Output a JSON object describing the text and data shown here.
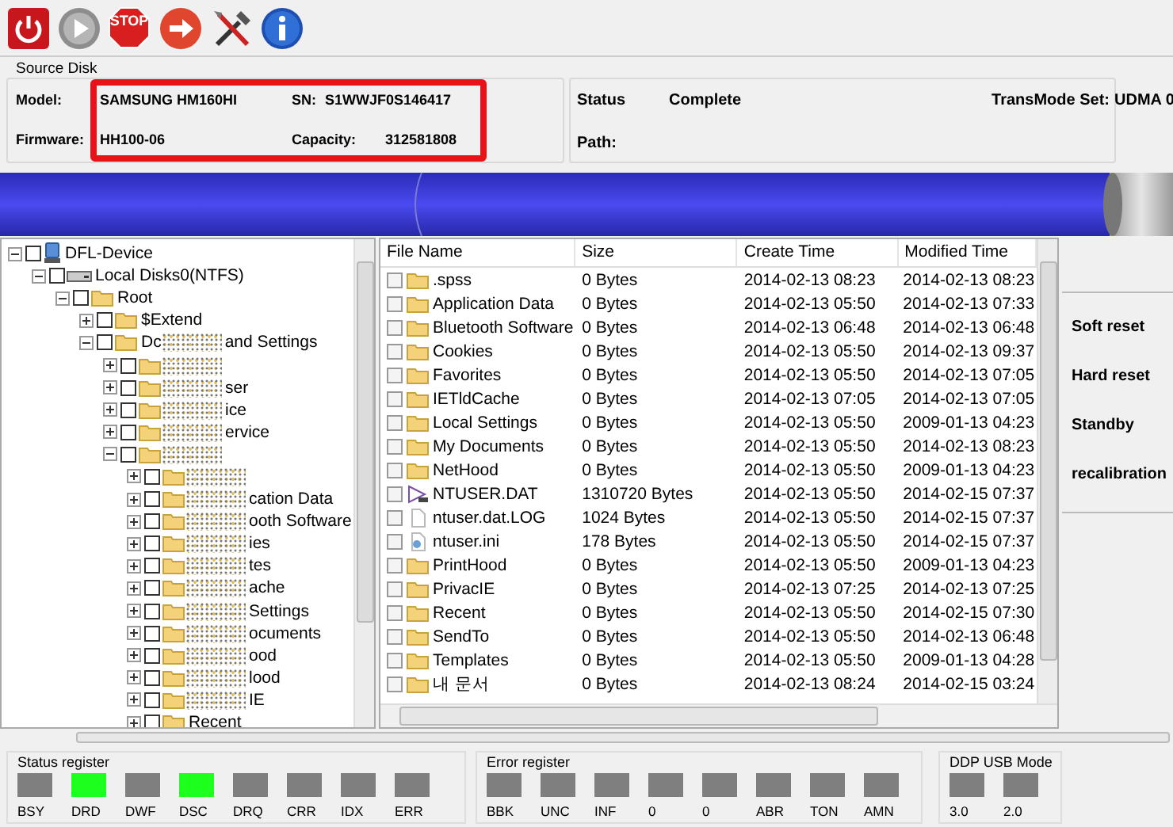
{
  "toolbar": [
    {
      "kind": "power"
    },
    {
      "kind": "play"
    },
    {
      "kind": "stop",
      "text": "STOP"
    },
    {
      "kind": "next"
    },
    {
      "kind": "tools"
    },
    {
      "kind": "info"
    }
  ],
  "source_disk": {
    "title": "Source Disk",
    "highlighted": true,
    "fields": [
      {
        "label": "Model:",
        "value": "SAMSUNG HM160HI"
      },
      {
        "label": "SN:",
        "value": "S1WWJF0S146417"
      },
      {
        "label": "Firmware:",
        "value": "HH100-06"
      },
      {
        "label": "Capacity:",
        "value": "312581808"
      }
    ]
  },
  "status_panel": {
    "status_label": "Status",
    "status": "Complete",
    "path_label": "Path:",
    "transmode_label": "TransMode Set:",
    "transmode": "UDMA 0"
  },
  "tree": [
    {
      "kind": "device",
      "label": "DFL-Device",
      "checked": false,
      "expanded": true,
      "children": [
        {
          "kind": "disk",
          "label": "Local Disks0(NTFS)",
          "checked": false,
          "expanded": true,
          "children": [
            {
              "kind": "folder",
              "label": "Root",
              "checked": false,
              "expanded": true,
              "children": [
                {
                  "kind": "folder",
                  "label": "$Extend",
                  "checked": false,
                  "expanded": false
                },
                {
                  "kind": "folder",
                  "prefix": "Dc",
                  "label": "and Settings",
                  "obscured": true,
                  "checked": false,
                  "expanded": true,
                  "children": [
                    {
                      "kind": "folder",
                      "obscured": true,
                      "checked": false,
                      "expanded": false
                    },
                    {
                      "kind": "folder",
                      "label": "ser",
                      "obscured": true,
                      "checked": false,
                      "expanded": false
                    },
                    {
                      "kind": "folder",
                      "label": "ice",
                      "obscured": true,
                      "checked": false,
                      "expanded": false
                    },
                    {
                      "kind": "folder",
                      "label": "ervice",
                      "obscured": true,
                      "checked": false,
                      "expanded": false
                    },
                    {
                      "kind": "folder",
                      "obscured": true,
                      "checked": false,
                      "expanded": true,
                      "children": [
                        {
                          "kind": "folder",
                          "obscured": true,
                          "checked": false,
                          "expanded": false
                        },
                        {
                          "kind": "folder",
                          "label": "cation Data",
                          "obscured": true,
                          "checked": false,
                          "expanded": false
                        },
                        {
                          "kind": "folder",
                          "label": "ooth Software",
                          "obscured": true,
                          "checked": false,
                          "expanded": false
                        },
                        {
                          "kind": "folder",
                          "label": "ies",
                          "obscured": true,
                          "checked": false,
                          "expanded": false
                        },
                        {
                          "kind": "folder",
                          "label": "tes",
                          "obscured": true,
                          "checked": false,
                          "expanded": false
                        },
                        {
                          "kind": "folder",
                          "label": "ache",
                          "obscured": true,
                          "checked": false,
                          "expanded": false
                        },
                        {
                          "kind": "folder",
                          "label": "Settings",
                          "obscured": true,
                          "checked": false,
                          "expanded": false
                        },
                        {
                          "kind": "folder",
                          "label": "ocuments",
                          "obscured": true,
                          "checked": false,
                          "expanded": false
                        },
                        {
                          "kind": "folder",
                          "label": "ood",
                          "obscured": true,
                          "checked": false,
                          "expanded": false
                        },
                        {
                          "kind": "folder",
                          "label": "lood",
                          "obscured": true,
                          "checked": false,
                          "expanded": false
                        },
                        {
                          "kind": "folder",
                          "label": "IE",
                          "obscured": true,
                          "checked": false,
                          "expanded": false
                        },
                        {
                          "kind": "folder",
                          "label": "Recent",
                          "checked": false,
                          "expanded": false
                        }
                      ]
                    }
                  ]
                }
              ]
            }
          ]
        }
      ]
    }
  ],
  "file_table": {
    "columns": [
      "File Name",
      "Size",
      "Create Time",
      "Modified Time"
    ],
    "rows": [
      {
        "kind": "folder",
        "checked": false,
        "cells": [
          ".spss",
          "0 Bytes",
          "2014-02-13  08:23",
          "2014-02-13  08:23"
        ]
      },
      {
        "kind": "folder",
        "checked": false,
        "cells": [
          "Application Data",
          "0 Bytes",
          "2014-02-13  05:50",
          "2014-02-13  07:33"
        ]
      },
      {
        "kind": "folder",
        "checked": false,
        "cells": [
          "Bluetooth Software",
          "0 Bytes",
          "2014-02-13  06:48",
          "2014-02-13  06:48"
        ]
      },
      {
        "kind": "folder",
        "checked": false,
        "cells": [
          "Cookies",
          "0 Bytes",
          "2014-02-13  05:50",
          "2014-02-13  09:37"
        ]
      },
      {
        "kind": "folder",
        "checked": false,
        "cells": [
          "Favorites",
          "0 Bytes",
          "2014-02-13  05:50",
          "2014-02-13  07:05"
        ]
      },
      {
        "kind": "folder",
        "checked": false,
        "cells": [
          "IETldCache",
          "0 Bytes",
          "2014-02-13  07:05",
          "2014-02-13  07:05"
        ]
      },
      {
        "kind": "folder",
        "checked": false,
        "cells": [
          "Local Settings",
          "0 Bytes",
          "2014-02-13  05:50",
          "2009-01-13  04:23"
        ]
      },
      {
        "kind": "folder",
        "checked": false,
        "cells": [
          "My Documents",
          "0 Bytes",
          "2014-02-13  05:50",
          "2014-02-13  08:23"
        ]
      },
      {
        "kind": "folder",
        "checked": false,
        "cells": [
          "NetHood",
          "0 Bytes",
          "2014-02-13  05:50",
          "2009-01-13  04:23"
        ]
      },
      {
        "kind": "dat",
        "checked": false,
        "cells": [
          "NTUSER.DAT",
          "1310720 Bytes",
          "2014-02-13  05:50",
          "2014-02-15  07:37"
        ]
      },
      {
        "kind": "file",
        "checked": false,
        "cells": [
          "ntuser.dat.LOG",
          "1024 Bytes",
          "2014-02-13  05:50",
          "2014-02-15  07:37"
        ]
      },
      {
        "kind": "ini",
        "checked": false,
        "cells": [
          "ntuser.ini",
          "178 Bytes",
          "2014-02-13  05:50",
          "2014-02-15  07:37"
        ]
      },
      {
        "kind": "folder",
        "checked": false,
        "cells": [
          "PrintHood",
          "0 Bytes",
          "2014-02-13  05:50",
          "2009-01-13  04:23"
        ]
      },
      {
        "kind": "folder",
        "checked": false,
        "cells": [
          "PrivacIE",
          "0 Bytes",
          "2014-02-13  07:25",
          "2014-02-13  07:25"
        ]
      },
      {
        "kind": "folder",
        "checked": false,
        "cells": [
          "Recent",
          "0 Bytes",
          "2014-02-13  05:50",
          "2014-02-15  07:30"
        ]
      },
      {
        "kind": "folder",
        "checked": false,
        "cells": [
          "SendTo",
          "0 Bytes",
          "2014-02-13  05:50",
          "2014-02-13  06:48"
        ]
      },
      {
        "kind": "folder",
        "checked": false,
        "cells": [
          "Templates",
          "0 Bytes",
          "2014-02-13  05:50",
          "2009-01-13  04:28"
        ]
      },
      {
        "kind": "folder",
        "checked": false,
        "cells": [
          "내 문서",
          "0 Bytes",
          "2014-02-13  08:24",
          "2014-02-15  03:24"
        ]
      }
    ]
  },
  "side_buttons": [
    "Soft reset",
    "Hard reset",
    "Standby",
    "recalibration"
  ],
  "registers": [
    {
      "title": "Status register",
      "lights": [
        {
          "label": "BSY",
          "on": false
        },
        {
          "label": "DRD",
          "on": true
        },
        {
          "label": "DWF",
          "on": false
        },
        {
          "label": "DSC",
          "on": true
        },
        {
          "label": "DRQ",
          "on": false
        },
        {
          "label": "CRR",
          "on": false
        },
        {
          "label": "IDX",
          "on": false
        },
        {
          "label": "ERR",
          "on": false
        }
      ]
    },
    {
      "title": "Error register",
      "lights": [
        {
          "label": "BBK",
          "on": false
        },
        {
          "label": "UNC",
          "on": false
        },
        {
          "label": "INF",
          "on": false
        },
        {
          "label": "0",
          "on": false
        },
        {
          "label": "0",
          "on": false
        },
        {
          "label": "ABR",
          "on": false
        },
        {
          "label": "TON",
          "on": false
        },
        {
          "label": "AMN",
          "on": false
        }
      ]
    },
    {
      "title": "DDP USB Mode",
      "lights": [
        {
          "label": "3.0",
          "on": false
        },
        {
          "label": "2.0",
          "on": false
        }
      ]
    }
  ]
}
